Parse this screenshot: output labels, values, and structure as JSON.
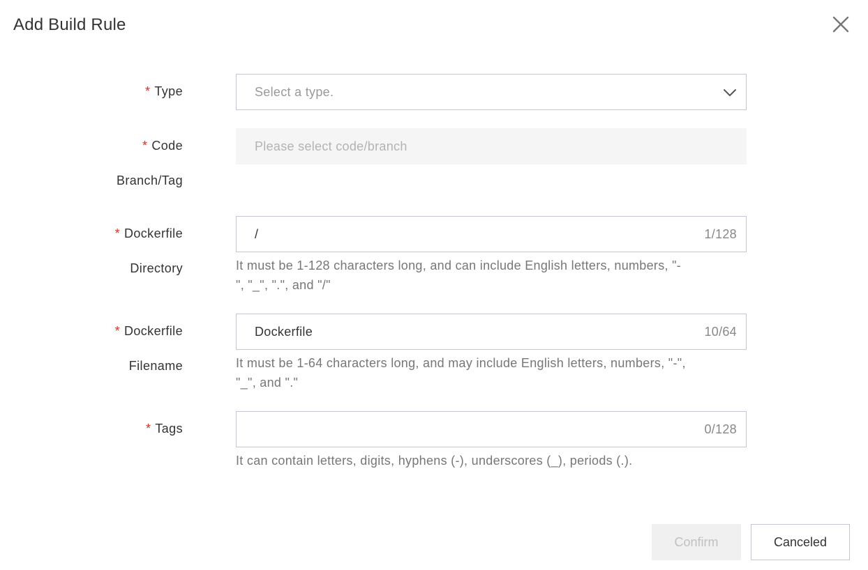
{
  "dialog": {
    "title": "Add Build Rule",
    "close_icon": "close-icon"
  },
  "form": {
    "type": {
      "required_mark": "*",
      "label": "Type",
      "placeholder": "Select a type.",
      "icon": "chevron-down-icon"
    },
    "code_branch": {
      "required_mark": "*",
      "label_line1": "Code",
      "label_line2": "Branch/Tag",
      "placeholder": "Please select code/branch"
    },
    "dockerfile_directory": {
      "required_mark": "*",
      "label_line1": "Dockerfile",
      "label_line2": "Directory",
      "value": "/",
      "counter": "1/128",
      "help_line1": "It must be 1-128 characters long, and can include English letters, numbers, \"-",
      "help_line2": "\", \"_\", \".\", and \"/\""
    },
    "dockerfile_filename": {
      "required_mark": "*",
      "label_line1": "Dockerfile",
      "label_line2": "Filename",
      "value": "Dockerfile",
      "counter": "10/64",
      "help_line1": "It must be 1-64 characters long, and may include English letters, numbers, \"-\",",
      "help_line2": "\"_\", and \".\""
    },
    "tags": {
      "required_mark": "*",
      "label": "Tags",
      "value": "",
      "counter": "0/128",
      "help": "It can contain letters, digits, hyphens (-), underscores (_), periods (.)."
    }
  },
  "footer": {
    "confirm_label": "Confirm",
    "cancel_label": "Canceled"
  },
  "colors": {
    "required": "#d93026",
    "border": "#c4c6cf",
    "disabled_bg": "#f5f5f5",
    "help_text": "#777777"
  }
}
